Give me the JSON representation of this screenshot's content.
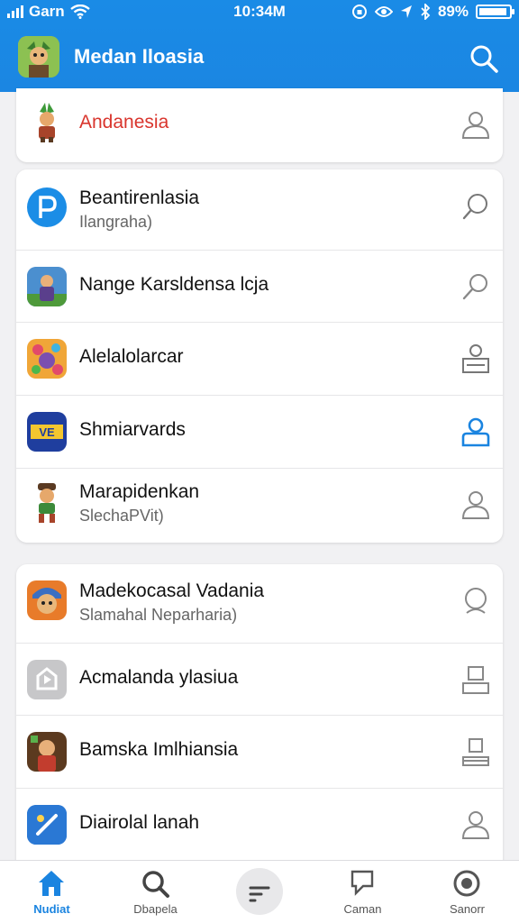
{
  "status_bar": {
    "carrier": "Garn",
    "time": "10:34M",
    "battery": "89%"
  },
  "app_bar": {
    "title": "Medan Iloasia"
  },
  "header_item": {
    "title": "Andanesia",
    "title_color": "#d9352d"
  },
  "group1": [
    {
      "title": "Beantirenlasia",
      "sub": "Ilangraha)",
      "icon": "search-icon"
    },
    {
      "title": "Nange Karsldensa lcja",
      "sub": "",
      "icon": "search-icon"
    },
    {
      "title": "Alelalolarcar",
      "sub": "",
      "icon": "user-card-icon"
    },
    {
      "title": "Shmiarvards",
      "sub": "",
      "icon": "user-icon-blue"
    },
    {
      "title": "Marapidenkan",
      "sub": "SlechaPVit)",
      "icon": "user-icon"
    }
  ],
  "group2": [
    {
      "title": "Madekocasal Vadania",
      "sub": "Slamahal Neparharia)",
      "icon": "user-icon"
    },
    {
      "title": "Acmalanda ylasiua",
      "sub": "",
      "icon": "user-card-icon"
    },
    {
      "title": "Bamska Imlhiansia",
      "sub": "",
      "icon": "user-card-icon"
    },
    {
      "title": "Diairolal lanah",
      "sub": "",
      "icon": "user-icon"
    }
  ],
  "bottom_nav": [
    {
      "label": "Nudiat",
      "icon": "home-icon"
    },
    {
      "label": "Dbapela",
      "icon": "search-icon"
    },
    {
      "label": "",
      "icon": "menu-icon"
    },
    {
      "label": "Caman",
      "icon": "chat-icon"
    },
    {
      "label": "Sanorr",
      "icon": "profile-icon"
    }
  ],
  "colors": {
    "accent": "#1a84e0",
    "header": "#1b86e2"
  }
}
